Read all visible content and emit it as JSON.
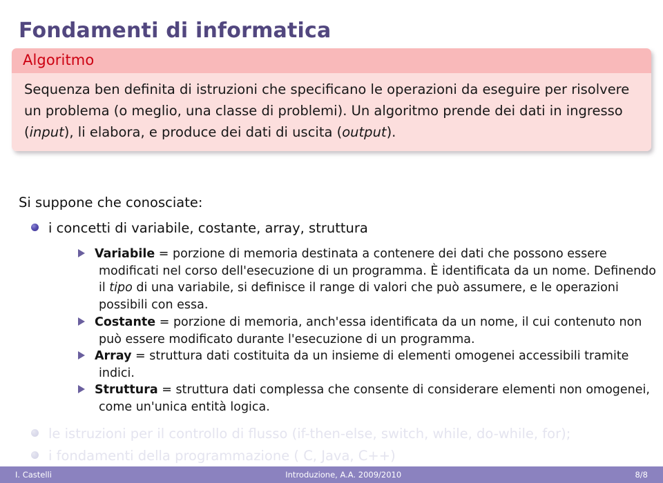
{
  "slide": {
    "title": "Fondamenti di informatica",
    "block": {
      "title": "Algoritmo",
      "body_part1": "Sequenza ben definita di istruzioni che specificano le operazioni da eseguire per risolvere un problema (o meglio, una classe di problemi). Un algoritmo prende dei dati in ingresso (",
      "body_italic1": "input",
      "body_part2": "), li elabora, e produce dei dati di uscita (",
      "body_italic2": "output",
      "body_part3": ")."
    },
    "intro": "Si suppone che conosciate:",
    "bullets": [
      {
        "label": "i concetti di variabile, costante, array, struttura",
        "dimmed": false
      },
      {
        "label": "le istruzioni per il controllo di flusso (if-then-else, switch, while, do-while, for);",
        "dimmed": true
      },
      {
        "label": "i fondamenti della programmazione ( C, Java, C++)",
        "dimmed": true
      }
    ],
    "definitions": [
      {
        "term": "Variabile",
        "eq": " = ",
        "text_a": "porzione di memoria destinata a contenere dei dati che possono essere modificati nel corso dell'esecuzione di un programma. È identificata da un nome. Definendo il ",
        "italic": "tipo",
        "text_b": " di una variabile, si definisce il range di valori che può assumere, e le operazioni possibili con essa."
      },
      {
        "term": "Costante",
        "eq": " = ",
        "text_a": "porzione di memoria, anch'essa identificata da un nome, il cui contenuto non può essere modificato durante l'esecuzione di un programma.",
        "italic": "",
        "text_b": ""
      },
      {
        "term": "Array",
        "eq": " = ",
        "text_a": "struttura dati costituita da un insieme di elementi omogenei accessibili tramite indici.",
        "italic": "",
        "text_b": ""
      },
      {
        "term": "Struttura",
        "eq": " = ",
        "text_a": "struttura dati complessa che consente di considerare elementi non omogenei, come un'unica entità logica.",
        "italic": "",
        "text_b": ""
      }
    ],
    "footer": {
      "author": "I. Castelli",
      "course": "Introduzione, A.A. 2009/2010",
      "page": "8/8"
    },
    "colors": {
      "title": "#52477f",
      "block_header_bg": "#f9b9ba",
      "block_header_text": "#cc0011",
      "block_body_bg": "#fcdedd",
      "footer_bg": "#8b82bf",
      "bullet": "#3b2f8f",
      "triangle": "#6a5f9e",
      "dimmed_text": "#e4e4ef"
    }
  }
}
